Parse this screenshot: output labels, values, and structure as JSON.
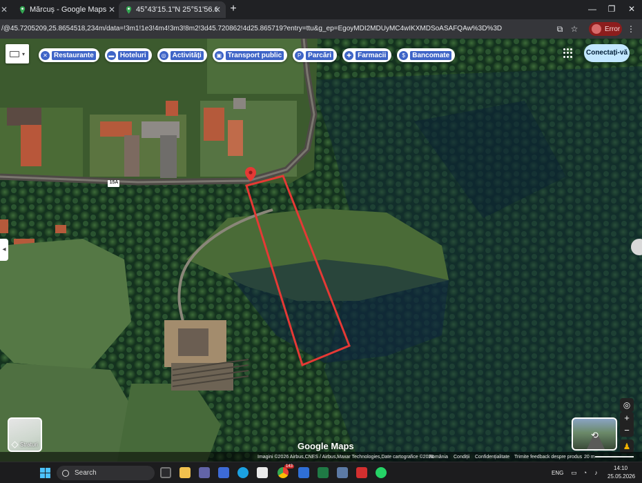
{
  "browser": {
    "tabs": [
      {
        "title": "Mărcuș - Google Maps",
        "active": false
      },
      {
        "title": "45°43'15.1\"N 25°51'56.6\"E - Go...",
        "active": true
      }
    ],
    "url": "/@45.7205209,25.8654518,234m/data=!3m1!1e3!4m4!3m3!8m2!3d45.720862!4d25.865719?entry=ttu&g_ep=EgoyMDI2MDUyMC4wIKXMDSoASAFQAw%3D%3D",
    "profile_error_label": "Error",
    "accent_color": "#8c1d1d"
  },
  "map": {
    "category_chips": [
      {
        "icon": "restaurant-icon",
        "label": "Restaurante"
      },
      {
        "icon": "hotel-icon",
        "label": "Hoteluri"
      },
      {
        "icon": "camera-icon",
        "label": "Activități"
      },
      {
        "icon": "transit-icon",
        "label": "Transport public"
      },
      {
        "icon": "parking-icon",
        "label": "Parcări"
      },
      {
        "icon": "pharmacy-icon",
        "label": "Farmacii"
      },
      {
        "icon": "atm-icon",
        "label": "Bancomate"
      }
    ],
    "sign_in_label": "Conectați-vă",
    "road_label": "15A",
    "layers_label": "Straturi",
    "logo_text": "Google Maps",
    "attribution": {
      "imagery": "Imagini ©2026 Airbus,CNES / Airbus,Maxar Technologies,Date cartografice ©2026",
      "country": "România",
      "terms": "Condiții",
      "privacy": "Confidențialitate",
      "feedback": "Trimite feedback despre produs",
      "scale": "20 m"
    },
    "colors": {
      "chip_accent": "#3e64c7",
      "marker": "#e53935",
      "highlight": "#e53935",
      "sign_in_bg": "#c2e7ff"
    }
  },
  "taskbar": {
    "search_label": "Search",
    "language": "ENG",
    "time": "14:10",
    "date": "25.05.2026",
    "badge_count": "143"
  }
}
